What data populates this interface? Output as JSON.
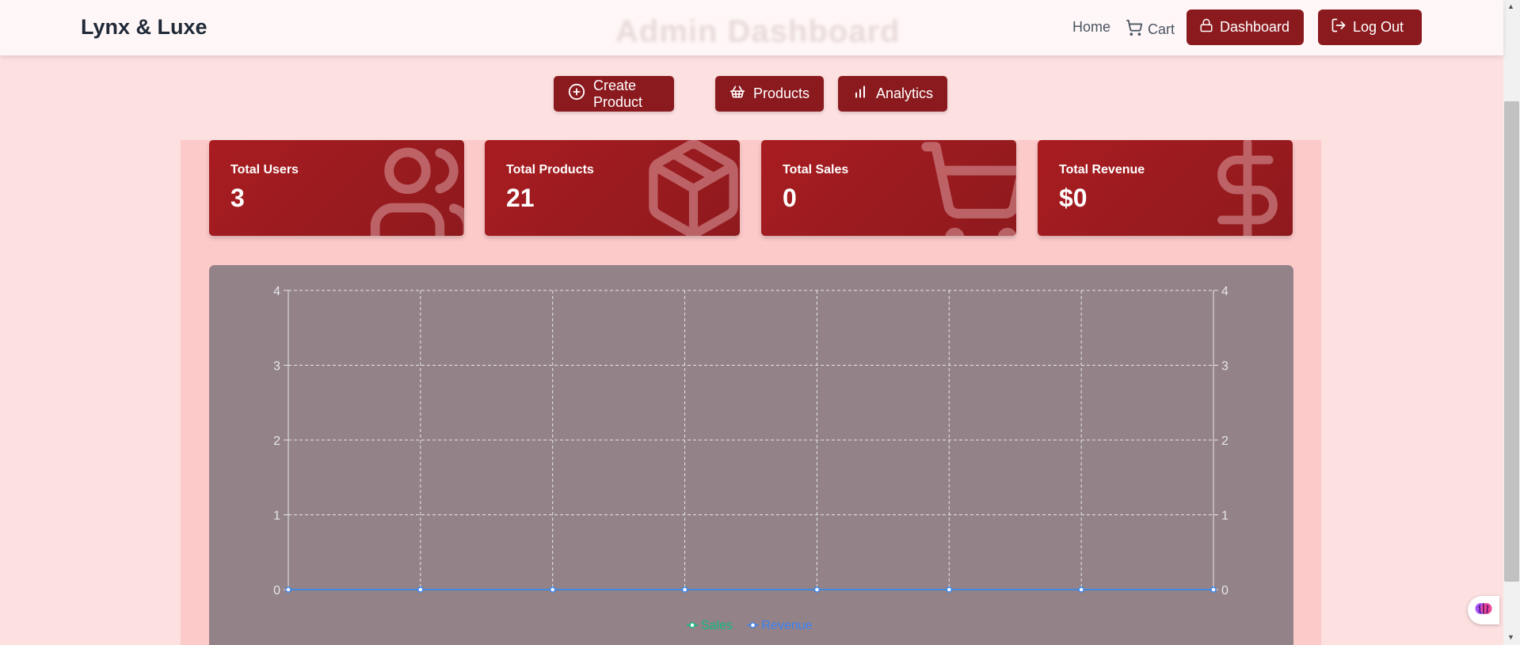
{
  "header": {
    "brand": "Lynx & Luxe",
    "faded_title": "Admin Dashboard",
    "nav_home": "Home",
    "nav_cart": "Cart",
    "dashboard_label": "Dashboard",
    "logout_label": "Log Out"
  },
  "tabs": [
    {
      "label": "Create Product",
      "icon": "plus-circle-icon"
    },
    {
      "label": "Products",
      "icon": "basket-icon"
    },
    {
      "label": "Analytics",
      "icon": "bar-chart-icon"
    }
  ],
  "stats": [
    {
      "label": "Total Users",
      "value": "3",
      "icon": "users-icon"
    },
    {
      "label": "Total Products",
      "value": "21",
      "icon": "package-icon"
    },
    {
      "label": "Total Sales",
      "value": "0",
      "icon": "shopping-cart-icon"
    },
    {
      "label": "Total Revenue",
      "value": "$0",
      "icon": "dollar-sign-icon"
    }
  ],
  "colors": {
    "accent": "#8b1a1f",
    "card": "#a81c20",
    "page_bg": "#fde0e0",
    "chart_bg": "#938288",
    "sales_series": "#10b981",
    "revenue_series": "#3b82f6"
  },
  "chart_data": {
    "type": "line",
    "x": [
      "",
      "",
      "",
      "",
      "",
      "",
      "",
      ""
    ],
    "series": [
      {
        "name": "Sales",
        "values": [
          0,
          0,
          0,
          0,
          0,
          0,
          0,
          0
        ],
        "color": "#10b981"
      },
      {
        "name": "Revenue",
        "values": [
          0,
          0,
          0,
          0,
          0,
          0,
          0,
          0
        ],
        "color": "#3b82f6"
      }
    ],
    "ylim": [
      0,
      4
    ],
    "y_ticks": [
      "0",
      "1",
      "2",
      "3",
      "4"
    ],
    "y2_ticks": [
      "0",
      "1",
      "2",
      "3",
      "4"
    ],
    "grid": true,
    "legend_position": "bottom-center"
  }
}
